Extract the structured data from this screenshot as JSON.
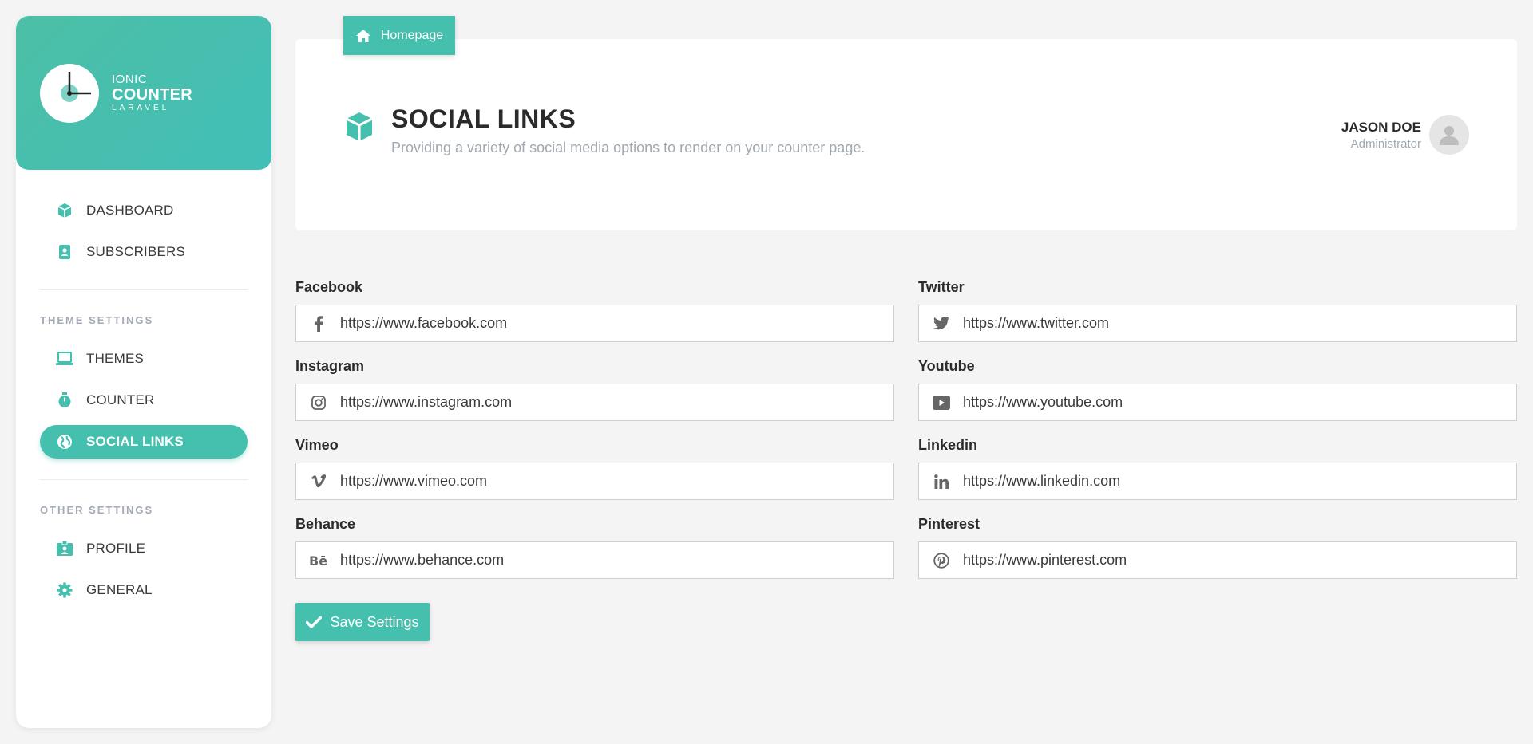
{
  "brand": {
    "line1": "IONIC",
    "line2": "COUNTER",
    "line3": "LARAVEL"
  },
  "sidebar": {
    "items_top": [
      {
        "label": "DASHBOARD",
        "icon": "cube-icon"
      },
      {
        "label": "SUBSCRIBERS",
        "icon": "address-book-icon"
      }
    ],
    "theme_settings_label": "THEME SETTINGS",
    "items_theme": [
      {
        "label": "THEMES",
        "icon": "laptop-icon"
      },
      {
        "label": "COUNTER",
        "icon": "stopwatch-icon"
      },
      {
        "label": "SOCIAL LINKS",
        "icon": "globe-icon",
        "active": true
      }
    ],
    "other_settings_label": "OTHER SETTINGS",
    "items_other": [
      {
        "label": "PROFILE",
        "icon": "id-badge-icon"
      },
      {
        "label": "GENERAL",
        "icon": "gear-icon"
      }
    ]
  },
  "header": {
    "homepage_label": "Homepage",
    "title": "SOCIAL LINKS",
    "subtitle": "Providing a variety of social media options to render on your counter page."
  },
  "user": {
    "name": "JASON DOE",
    "role": "Administrator"
  },
  "form": {
    "fields": [
      {
        "label": "Facebook",
        "value": "https://www.facebook.com",
        "icon": "facebook-icon"
      },
      {
        "label": "Twitter",
        "value": "https://www.twitter.com",
        "icon": "twitter-icon"
      },
      {
        "label": "Instagram",
        "value": "https://www.instagram.com",
        "icon": "instagram-icon"
      },
      {
        "label": "Youtube",
        "value": "https://www.youtube.com",
        "icon": "youtube-icon"
      },
      {
        "label": "Vimeo",
        "value": "https://www.vimeo.com",
        "icon": "vimeo-icon"
      },
      {
        "label": "Linkedin",
        "value": "https://www.linkedin.com",
        "icon": "linkedin-icon"
      },
      {
        "label": "Behance",
        "value": "https://www.behance.com",
        "icon": "behance-icon"
      },
      {
        "label": "Pinterest",
        "value": "https://www.pinterest.com",
        "icon": "pinterest-icon"
      }
    ],
    "save_label": "Save Settings"
  },
  "colors": {
    "accent": "#45bfae",
    "background": "#f4f4f4",
    "muted": "#a0a8b0"
  }
}
